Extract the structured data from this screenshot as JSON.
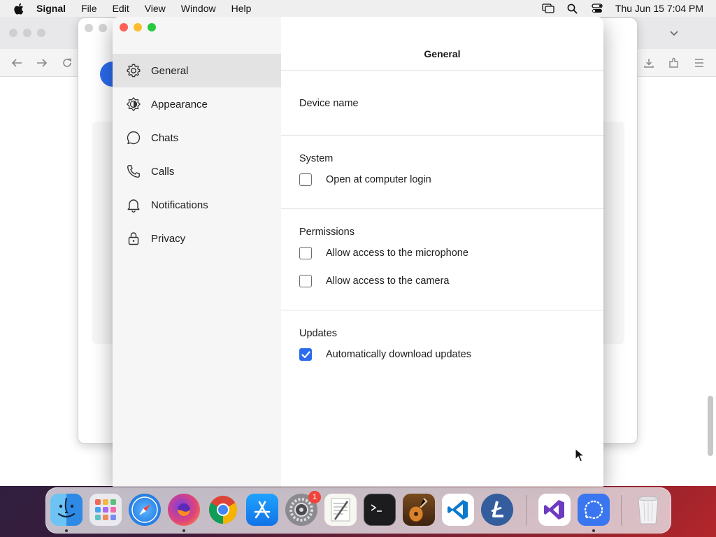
{
  "menubar": {
    "app_name": "Signal",
    "items": [
      "File",
      "Edit",
      "View",
      "Window",
      "Help"
    ],
    "clock": "Thu Jun 15  7:04 PM"
  },
  "settings": {
    "nav": [
      {
        "label": "General",
        "icon": "gear-icon",
        "active": true
      },
      {
        "label": "Appearance",
        "icon": "appearance-icon",
        "active": false
      },
      {
        "label": "Chats",
        "icon": "chat-bubble-icon",
        "active": false
      },
      {
        "label": "Calls",
        "icon": "phone-icon",
        "active": false
      },
      {
        "label": "Notifications",
        "icon": "bell-icon",
        "active": false
      },
      {
        "label": "Privacy",
        "icon": "lock-icon",
        "active": false
      }
    ],
    "title": "General",
    "device_name_label": "Device name",
    "system": {
      "label": "System",
      "open_at_login": {
        "label": "Open at computer login",
        "checked": false
      }
    },
    "permissions": {
      "label": "Permissions",
      "microphone": {
        "label": "Allow access to the microphone",
        "checked": false
      },
      "camera": {
        "label": "Allow access to the camera",
        "checked": false
      }
    },
    "updates": {
      "label": "Updates",
      "auto_download": {
        "label": "Automatically download updates",
        "checked": true
      }
    }
  },
  "dock": {
    "apps": [
      "Finder",
      "Launchpad",
      "Safari",
      "Firefox",
      "Chrome",
      "App Store",
      "System Settings",
      "TextEdit",
      "Terminal",
      "GarageBand",
      "Visual Studio Code",
      "Litecoin",
      "Visual Studio",
      "Signal",
      "Trash"
    ],
    "settings_badge": "1"
  },
  "colors": {
    "accent": "#2c6bed",
    "sidebar_bg": "#f6f6f6",
    "active_nav_bg": "#e3e3e3"
  }
}
